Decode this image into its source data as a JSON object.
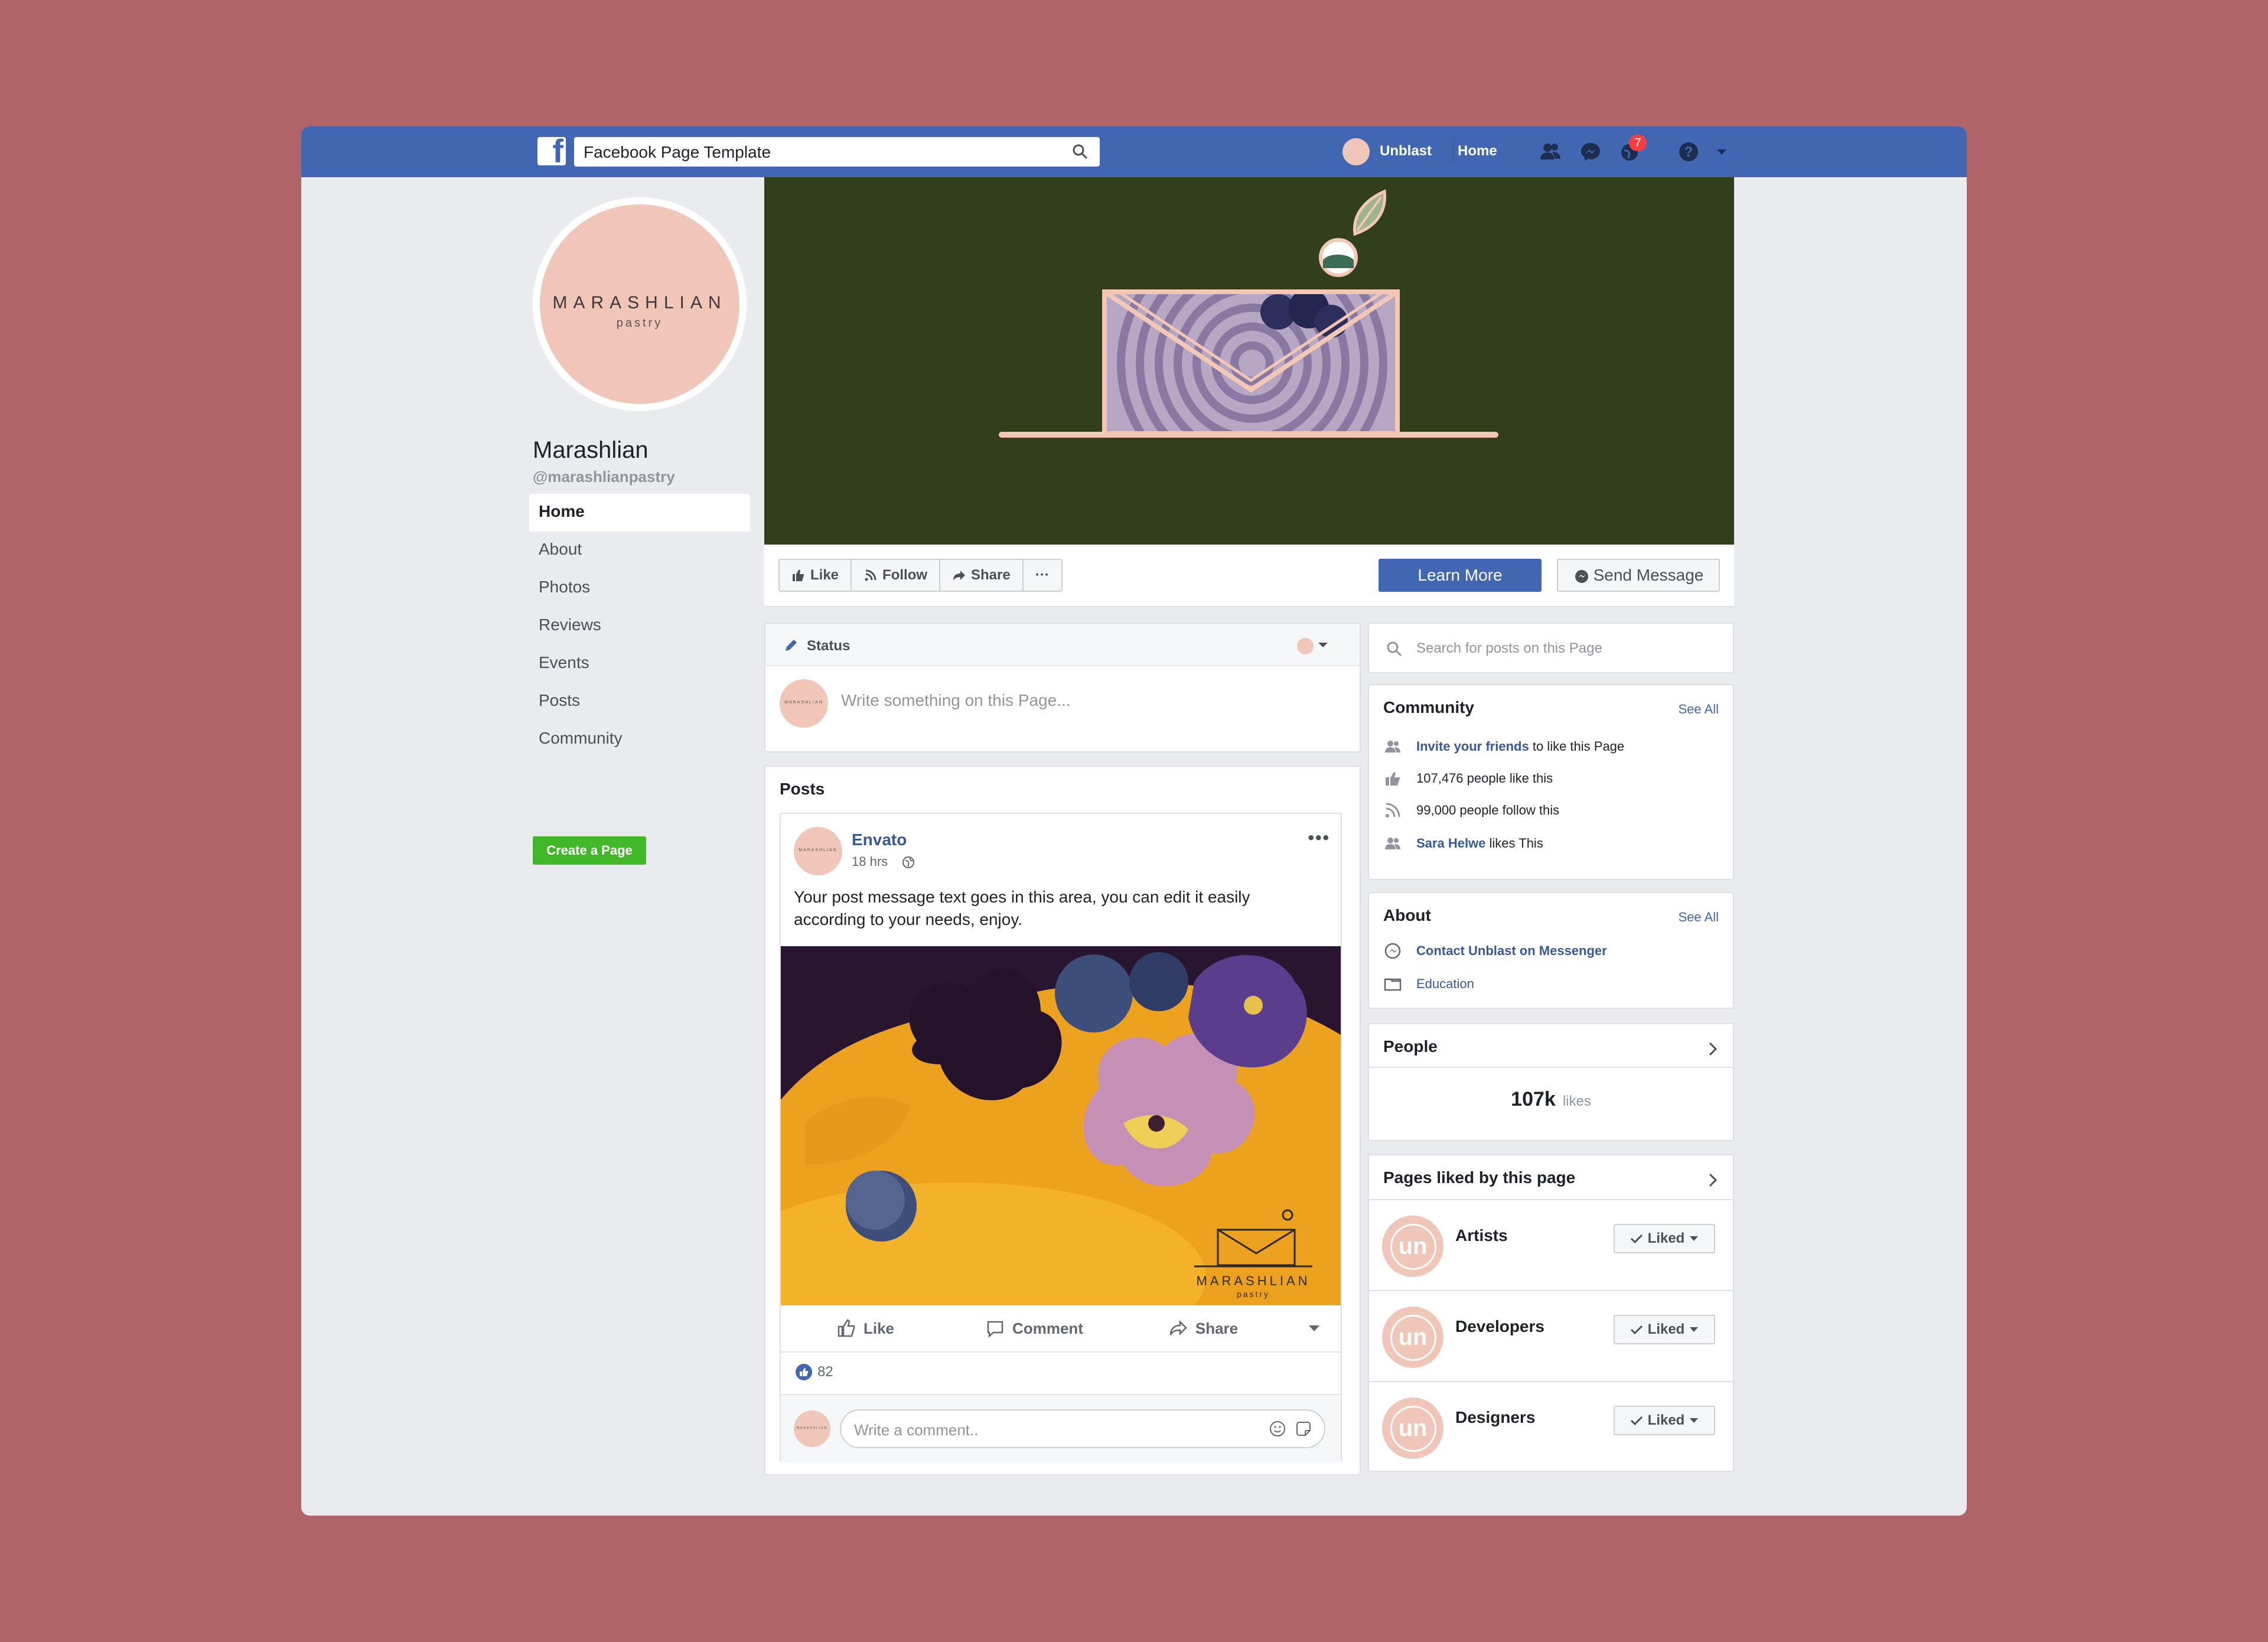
{
  "topbar": {
    "search_value": "Facebook Page Template",
    "user_name": "Unblast",
    "home_label": "Home",
    "notification_count": "7"
  },
  "profile": {
    "logo_line1": "MARASHLIAN",
    "logo_line2": "pastry",
    "page_name": "Marashlian",
    "handle": "@marashlianpastry"
  },
  "nav": {
    "items": [
      "Home",
      "About",
      "Photos",
      "Reviews",
      "Events",
      "Posts",
      "Community"
    ],
    "create_page_label": "Create a Page"
  },
  "actions": {
    "like": "Like",
    "follow": "Follow",
    "share": "Share",
    "more": "···",
    "learn_more": "Learn More",
    "send_message": "Send Message"
  },
  "composer": {
    "status_label": "Status",
    "placeholder": "Write something on this Page..."
  },
  "posts": {
    "title": "Posts",
    "post": {
      "author": "Envato",
      "time": "18 hrs",
      "text": "Your post message text goes in this area, you can edit it easily according to your needs, enjoy.",
      "image_watermark": "MARASHLIAN",
      "image_watermark_sub": "pastry",
      "like_label": "Like",
      "comment_label": "Comment",
      "share_label": "Share",
      "reaction_count": "82",
      "comment_placeholder": "Write a comment.."
    }
  },
  "sidebar_right": {
    "search_placeholder": "Search for posts on this Page",
    "community": {
      "title": "Community",
      "see_all": "See All",
      "invite_link": "Invite your friends",
      "invite_rest": "to like this Page",
      "likes": "107,476 people like this",
      "follows": "99,000 people follow this",
      "friend_name": "Sara Helwe",
      "friend_rest": "likes This"
    },
    "about": {
      "title": "About",
      "see_all": "See All",
      "messenger": "Contact Unblast on Messenger",
      "category": "Education"
    },
    "people": {
      "title": "People",
      "count": "107k",
      "unit": "likes"
    },
    "pages_liked": {
      "title": "Pages liked by this page",
      "button_label": "Liked",
      "logo_text": "un",
      "items": [
        "Artists",
        "Developers",
        "Designers"
      ]
    }
  },
  "colors": {
    "background": "#b16467",
    "fb_blue": "#4267b2",
    "cover_green": "#323f1c",
    "peach": "#f0c6b9",
    "create_green": "#42b72a"
  }
}
